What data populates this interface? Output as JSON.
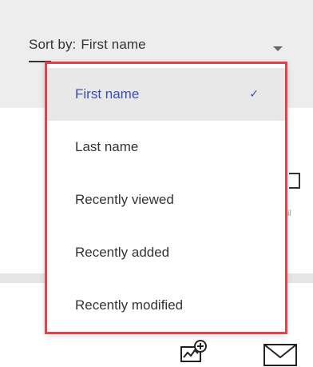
{
  "sort": {
    "label": "Sort by:",
    "value": "First name"
  },
  "dropdown": {
    "options": [
      {
        "label": "First name",
        "selected": true
      },
      {
        "label": "Last name",
        "selected": false
      },
      {
        "label": "Recently viewed",
        "selected": false
      },
      {
        "label": "Recently added",
        "selected": false
      },
      {
        "label": "Recently modified",
        "selected": false
      }
    ],
    "check_glyph": "✓"
  },
  "background": {
    "ghost_label": "il"
  },
  "icons": {
    "analytics": "chart-plus-icon",
    "mail": "mail-icon"
  },
  "colors": {
    "accent": "#3b4fb0",
    "highlight_outline": "#e0434a",
    "selected_bg": "#e8e8e8"
  }
}
